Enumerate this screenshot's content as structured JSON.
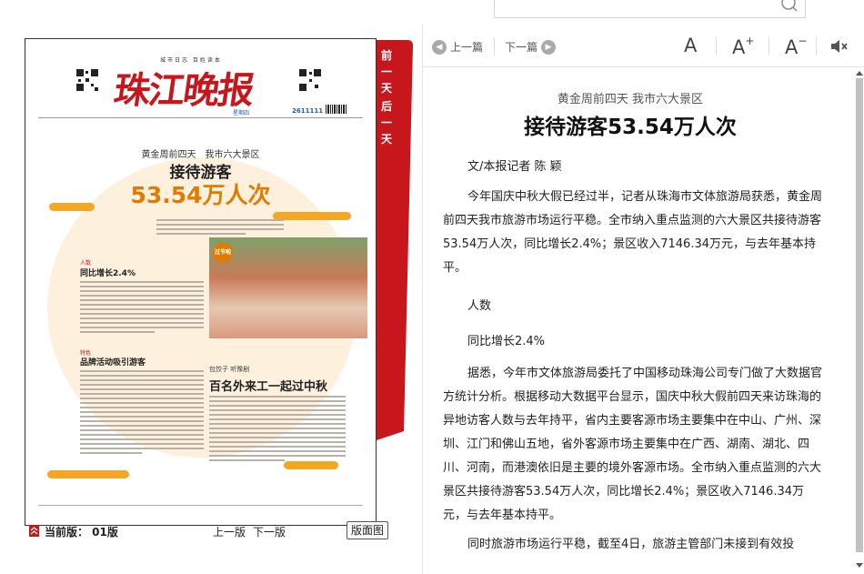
{
  "side_tabs": [
    "前",
    "一",
    "天",
    "后",
    "一",
    "天"
  ],
  "colors": {
    "accent_red": "#c8161d",
    "orange": "#e07b00"
  },
  "bottom_bar": {
    "current_label": "当前版： 01版",
    "prev_edition": "上一版",
    "next_edition": "下一版",
    "layout_button": "版面图"
  },
  "newspaper": {
    "masthead": "珠江晚报",
    "motto": "城市日志 百姓读本",
    "issue_number": "2611111",
    "weekday": "星期四",
    "subtitle": "黄金周前四天　我市六大景区",
    "headline_1": "接待游客",
    "headline_2": "53.54万人次",
    "section_1_tag": "人数",
    "section_1_title": "同比增长2.4%",
    "section_2_tag": "特色",
    "section_2_title": "品牌活动吸引游客",
    "bottom_subtitle": "包饺子 听豫剧",
    "bottom_headline": "百名外来工一起过中秋",
    "photo_badge": "过节啦"
  },
  "toolbar": {
    "prev_article": "上一篇",
    "next_article": "下一篇",
    "font_normal": "A",
    "font_increase": "A",
    "font_decrease": "A",
    "plus": "+",
    "minus": "−"
  },
  "article": {
    "subtitle": "黄金周前四天 我市六大景区",
    "title": "接待游客53.54万人次",
    "author": "文/本报记者 陈 颖",
    "para_1": "今年国庆中秋大假已经过半，记者从珠海市文体旅游局获悉，黄金周前四天我市旅游市场运行平稳。全市纳入重点监测的六大景区共接待游客53.54万人次，同比增长2.4%；景区收入7146.34万元，与去年基本持平。",
    "short_1": "人数",
    "short_2": "同比增长2.4%",
    "para_2": "据悉，今年市文体旅游局委托了中国移动珠海公司专门做了大数据官方统计分析。根据移动大数据平台显示，国庆中秋大假前四天来访珠海的异地访客人数与去年持平，省内主要客源市场主要集中在中山、广州、深圳、江门和佛山五地，省外客源市场主要集中在广西、湖南、湖北、四川、河南，而港澳依旧是主要的境外客源市场。全市纳入重点监测的六大景区共接待游客53.54万人次，同比增长2.4%；景区收入7146.34万元，与去年基本持平。",
    "para_3": "同时旅游市场运行平稳，截至4日，旅游主管部门未接到有效投"
  }
}
